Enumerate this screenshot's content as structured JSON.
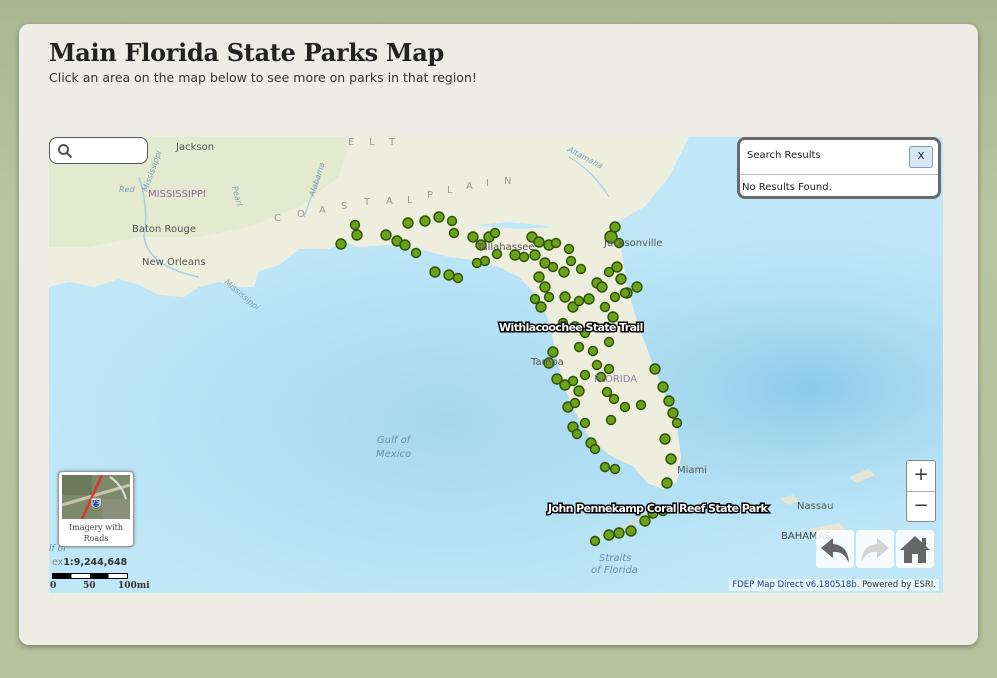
{
  "page": {
    "title": "Main Florida State Parks Map",
    "subtitle": "Click an area on the map below to see more on parks in that region!"
  },
  "map": {
    "search": {
      "placeholder": ""
    },
    "results": {
      "header": "Search Results",
      "close_label": "X",
      "message": "No Results Found."
    },
    "labels": {
      "jackson": "Jackson",
      "mississippi": "MISSISSIPPI",
      "red": "Red",
      "mississippi_river": "Mississippi",
      "pearl": "Pearl",
      "alabama_river": "Alabama",
      "altamaha": "Altamaha",
      "coastal_letters": [
        "C",
        "O",
        "A",
        "S",
        "T",
        "A",
        "L"
      ],
      "plain_letters": [
        "P",
        "L",
        "A",
        "I",
        "N"
      ],
      "belt_letters": [
        "E",
        "L",
        "T"
      ],
      "baton_rouge": "Baton Rouge",
      "new_orleans": "New Orleans",
      "mississippi_lower": "Mississippi",
      "tallahassee": "Tallahassee",
      "jacksonville": "Jacksonville",
      "orlando": "Orlando",
      "tampa": "Tampa",
      "florida": "FLORIDA",
      "gulf_of_mexico_1": "Gulf of",
      "gulf_of_mexico_2": "Mexico",
      "miami": "Miami",
      "nassau": "Nassau",
      "bahamas": "BAHAMAS",
      "straits_1": "Straits",
      "straits_2": "of Florida",
      "gulf_small": "lf of"
    },
    "park_labels": {
      "withlacoochee": "Withlacoochee State Trail",
      "pennekamp": "John Pennekamp Coral Reef State Park"
    },
    "basemap_toggle": {
      "caption": "Imagery with\nRoads",
      "highway_shield": "75"
    },
    "scale": {
      "ratio": "1:9,244,648",
      "ratio_prefix": "ex",
      "ticks": [
        "0",
        "50",
        "100mi"
      ]
    },
    "zoom": {
      "in_label": "+",
      "out_label": "−"
    },
    "nav": {
      "back": "back-arrow-icon",
      "forward": "forward-arrow-icon",
      "home": "home-icon"
    },
    "credit": {
      "link_text": "FDEP Map Direct v6.180518b.",
      "suffix": " Powered by ESRI."
    },
    "colors": {
      "park_marker": "#6aa21a",
      "park_outline": "#2f4f08",
      "land": "#f2f0e6",
      "water": "#b8e3f7"
    }
  }
}
